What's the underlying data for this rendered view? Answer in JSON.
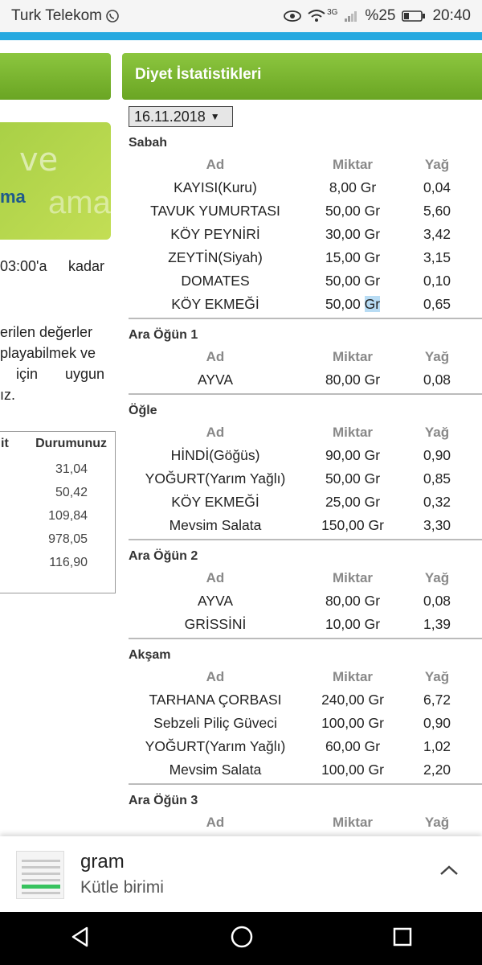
{
  "status_bar": {
    "carrier": "Turk Telekom",
    "network": "3G",
    "battery": "%25",
    "time": "20:40"
  },
  "left_panel": {
    "banner_text_1": "ve",
    "banner_text_2": "ma",
    "banner_text_3": "ama",
    "text1_line1_a": "03:00'a",
    "text1_line1_b": "kadar",
    "text2_line1": "erilen değerler",
    "text2_line2": "playabilmek ve",
    "text2_line3_a": "için",
    "text2_line3_b": "uygun",
    "text2_line4": "ız.",
    "table_header_1": "it",
    "table_header_2": "Durumunuz",
    "table_paren": ")",
    "table_values": [
      "31,04",
      "50,42",
      "109,84",
      "978,05",
      "116,90"
    ]
  },
  "diet": {
    "title": "Diyet İstatistikleri",
    "date": "16.11.2018",
    "col_ad": "Ad",
    "col_miktar": "Miktar",
    "col_yag": "Yağ",
    "meals": [
      {
        "name": "Sabah",
        "items": [
          {
            "ad": "KAYISI(Kuru)",
            "miktar": "8,00 Gr",
            "yag": "0,04"
          },
          {
            "ad": "TAVUK YUMURTASI",
            "miktar": "50,00 Gr",
            "yag": "5,60"
          },
          {
            "ad": "KÖY PEYNİRİ",
            "miktar": "30,00 Gr",
            "yag": "3,42"
          },
          {
            "ad": "ZEYTİN(Siyah)",
            "miktar": "15,00 Gr",
            "yag": "3,15"
          },
          {
            "ad": "DOMATES",
            "miktar": "50,00 Gr",
            "yag": "0,10"
          },
          {
            "ad": "KÖY EKMEĞİ",
            "miktar_num": "50,00",
            "miktar_unit": "Gr",
            "yag": "0,65",
            "highlight": true
          }
        ]
      },
      {
        "name": "Ara Öğün 1",
        "items": [
          {
            "ad": "AYVA",
            "miktar": "80,00 Gr",
            "yag": "0,08"
          }
        ]
      },
      {
        "name": "Öğle",
        "items": [
          {
            "ad": "HİNDİ(Göğüs)",
            "miktar": "90,00 Gr",
            "yag": "0,90"
          },
          {
            "ad": "YOĞURT(Yarım Yağlı)",
            "miktar": "50,00 Gr",
            "yag": "0,85"
          },
          {
            "ad": "KÖY EKMEĞİ",
            "miktar": "25,00 Gr",
            "yag": "0,32"
          },
          {
            "ad": "Mevsim Salata",
            "miktar": "150,00 Gr",
            "yag": "3,30"
          }
        ]
      },
      {
        "name": "Ara Öğün 2",
        "items": [
          {
            "ad": "AYVA",
            "miktar": "80,00 Gr",
            "yag": "0,08"
          },
          {
            "ad": "GRİSSİNİ",
            "miktar": "10,00 Gr",
            "yag": "1,39"
          }
        ]
      },
      {
        "name": "Akşam",
        "items": [
          {
            "ad": "TARHANA ÇORBASI",
            "miktar": "240,00 Gr",
            "yag": "6,72"
          },
          {
            "ad": "Sebzeli Piliç Güveci",
            "miktar": "100,00 Gr",
            "yag": "0,90"
          },
          {
            "ad": "YOĞURT(Yarım Yağlı)",
            "miktar": "60,00 Gr",
            "yag": "1,02"
          },
          {
            "ad": "Mevsim Salata",
            "miktar": "100,00 Gr",
            "yag": "2,20"
          }
        ]
      },
      {
        "name": "Ara Öğün 3",
        "items": []
      }
    ]
  },
  "suggestion": {
    "title": "gram",
    "subtitle": "Kütle birimi"
  },
  "colors": {
    "accent_blue": "#26a9e0",
    "header_green": "#7ab52f",
    "highlight": "#b8dcf4"
  }
}
